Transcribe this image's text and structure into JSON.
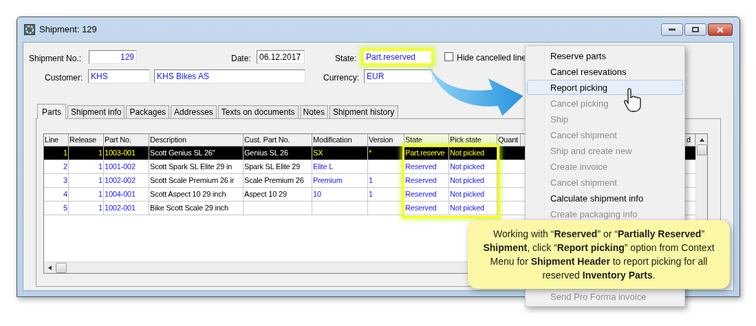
{
  "window": {
    "title": "Shipment: 129"
  },
  "header": {
    "shipment_no": {
      "label": "Shipment No.:",
      "value": "129"
    },
    "date": {
      "label": "Date:",
      "value": "06.12.2017"
    },
    "state": {
      "label": "State:",
      "value": "Part.reserved",
      "highlighted": true
    },
    "customer": {
      "label": "Customer:",
      "code": "KHS",
      "name": "KHS Bikes AS"
    },
    "currency": {
      "label": "Currency:",
      "value": "EUR"
    },
    "hide_cancelled": {
      "label": "Hide cancelled line",
      "checked": false
    }
  },
  "tabs": [
    {
      "label": "Parts",
      "selected": true
    },
    {
      "label": "Shipment info",
      "selected": false
    },
    {
      "label": "Packages",
      "selected": false
    },
    {
      "label": "Addresses",
      "selected": false
    },
    {
      "label": "Texts on documents",
      "selected": false
    },
    {
      "label": "Notes",
      "selected": false
    },
    {
      "label": "Shipment history",
      "selected": false
    }
  ],
  "table": {
    "columns": [
      {
        "label": "Line",
        "highlighted": false
      },
      {
        "label": "Release",
        "highlighted": false
      },
      {
        "label": "Part No.",
        "highlighted": false
      },
      {
        "label": "Description",
        "highlighted": false
      },
      {
        "label": "Cust. Part No.",
        "highlighted": false
      },
      {
        "label": "Modification",
        "highlighted": false
      },
      {
        "label": "Version",
        "highlighted": false
      },
      {
        "label": "State",
        "highlighted": true
      },
      {
        "label": "Pick state",
        "highlighted": true
      },
      {
        "label": "Quant",
        "highlighted": false
      },
      {
        "label": "d",
        "highlighted": false
      }
    ],
    "rows": [
      {
        "selected": true,
        "cells": [
          "1",
          "1",
          "1003-001",
          "Scott Genius SL 26''",
          "Genius SL 26",
          "SX",
          "*",
          "Part.reserve",
          "Not picked"
        ]
      },
      {
        "selected": false,
        "cells": [
          "2",
          "1",
          "1001-002",
          "Scott Spark SL Elite 29 in",
          "Spark SL Elite 29",
          "Elite L",
          "",
          "Reserved",
          "Not picked"
        ]
      },
      {
        "selected": false,
        "cells": [
          "3",
          "1",
          "1002-002",
          "Scott Scale Premium 26 ir",
          "Scale Premium 26",
          "Premium",
          "1",
          "Reserved",
          "Not picked"
        ]
      },
      {
        "selected": false,
        "cells": [
          "4",
          "1",
          "1004-001",
          "Scott Aspect 10 29 inch",
          "Aspect 10 29",
          "10",
          "1",
          "Reserved",
          "Not picked"
        ]
      },
      {
        "selected": false,
        "cells": [
          "5",
          "1",
          "1002-001",
          "Bike Scott Scale 29 inch",
          "",
          "",
          "",
          "Reserved",
          "Not picked"
        ]
      }
    ]
  },
  "context_menu": [
    {
      "label": "Reserve parts",
      "disabled": false,
      "selected": false
    },
    {
      "label": "Cancel resevations",
      "disabled": false,
      "selected": false
    },
    {
      "label": "Report picking",
      "disabled": false,
      "selected": true
    },
    {
      "label": "Cancel picking",
      "disabled": true,
      "selected": false
    },
    {
      "label": "Ship",
      "disabled": true,
      "selected": false
    },
    {
      "label": "Cancel shipment",
      "disabled": true,
      "selected": false
    },
    {
      "label": "Ship and create new",
      "disabled": true,
      "selected": false
    },
    {
      "label": "Create invoice",
      "disabled": true,
      "selected": false
    },
    {
      "label": "Cancel shipment",
      "disabled": true,
      "selected": false
    },
    {
      "label": "Calculate shipment info",
      "disabled": false,
      "selected": false
    },
    {
      "label": "Create packaging info",
      "disabled": true,
      "selected": false
    },
    {
      "kind": "hidden"
    },
    {
      "kind": "hidden"
    },
    {
      "kind": "hidden"
    },
    {
      "kind": "hidden"
    },
    {
      "label": "Send Pro Forma invoice",
      "disabled": true,
      "selected": false
    }
  ],
  "callout": {
    "text": "Working with “**Reserved**” or “**Partially Reserved**” **Shipment**, click “**Report picking**” option from Context Menu for **Shipment Header** to report picking for all reserved **Inventory Parts**."
  }
}
